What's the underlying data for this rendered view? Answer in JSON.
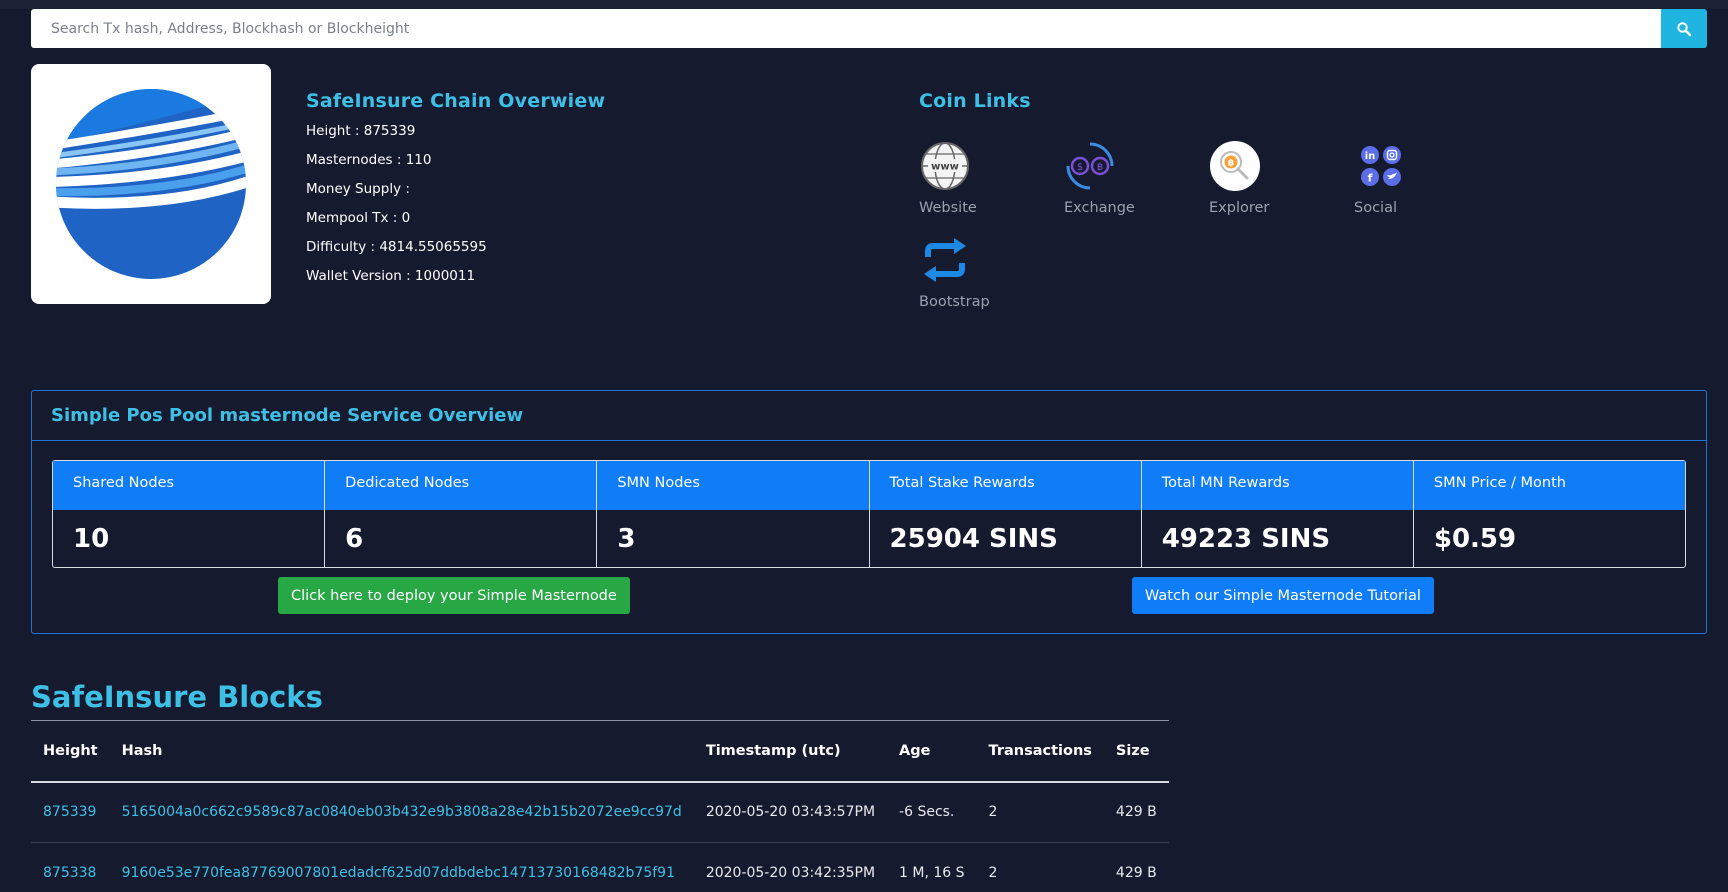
{
  "search": {
    "placeholder": "Search Tx hash, Address, Blockhash or Blockheight",
    "icon": "search-icon"
  },
  "overview": {
    "title": "SafeInsure Chain Overwiew",
    "stats": [
      "Height : 875339",
      "Masternodes : 110",
      "Money Supply :",
      "Mempool Tx : 0",
      "Difficulty : 4814.55065595",
      "Wallet Version : 1000011"
    ]
  },
  "coin_links": {
    "title": "Coin Links",
    "items": [
      {
        "label": "Website",
        "icon": "globe-www-icon"
      },
      {
        "label": "Exchange",
        "icon": "exchange-icon"
      },
      {
        "label": "Explorer",
        "icon": "explorer-bitcoin-magnifier-icon"
      },
      {
        "label": "Social",
        "icon": "social-icons"
      },
      {
        "label": "Bootstrap",
        "icon": "refresh-arrows-icon"
      }
    ]
  },
  "pool": {
    "title": "Simple Pos Pool masternode Service Overview",
    "columns": [
      {
        "label": "Shared Nodes",
        "value": "10"
      },
      {
        "label": "Dedicated Nodes",
        "value": "6"
      },
      {
        "label": "SMN Nodes",
        "value": "3"
      },
      {
        "label": "Total Stake Rewards",
        "value": "25904 SINS"
      },
      {
        "label": "Total MN Rewards",
        "value": "49223 SINS"
      },
      {
        "label": "SMN Price / Month",
        "value": "$0.59"
      }
    ],
    "deploy_label": "Click here to deploy your Simple Masternode",
    "tutorial_label": "Watch our Simple Masternode Tutorial"
  },
  "blocks": {
    "title": "SafeInsure Blocks",
    "headers": [
      "Height",
      "Hash",
      "Timestamp (utc)",
      "Age",
      "Transactions",
      "Size"
    ],
    "rows": [
      [
        "875339",
        "5165004a0c662c9589c87ac0840eb03b432e9b3808a28e42b15b2072ee9cc97d",
        "2020-05-20 03:43:57PM",
        "-6 Secs.",
        "2",
        "429 B"
      ],
      [
        "875338",
        "9160e53e770fea87769007801edadcf625d07ddbdebc14713730168482b75f91",
        "2020-05-20 03:42:35PM",
        "1 M, 16 S",
        "2",
        "429 B"
      ]
    ]
  },
  "colors": {
    "background": "#161a2e",
    "accent": "#3ec0e6",
    "primary": "#0f7df7",
    "success": "#28a745"
  }
}
